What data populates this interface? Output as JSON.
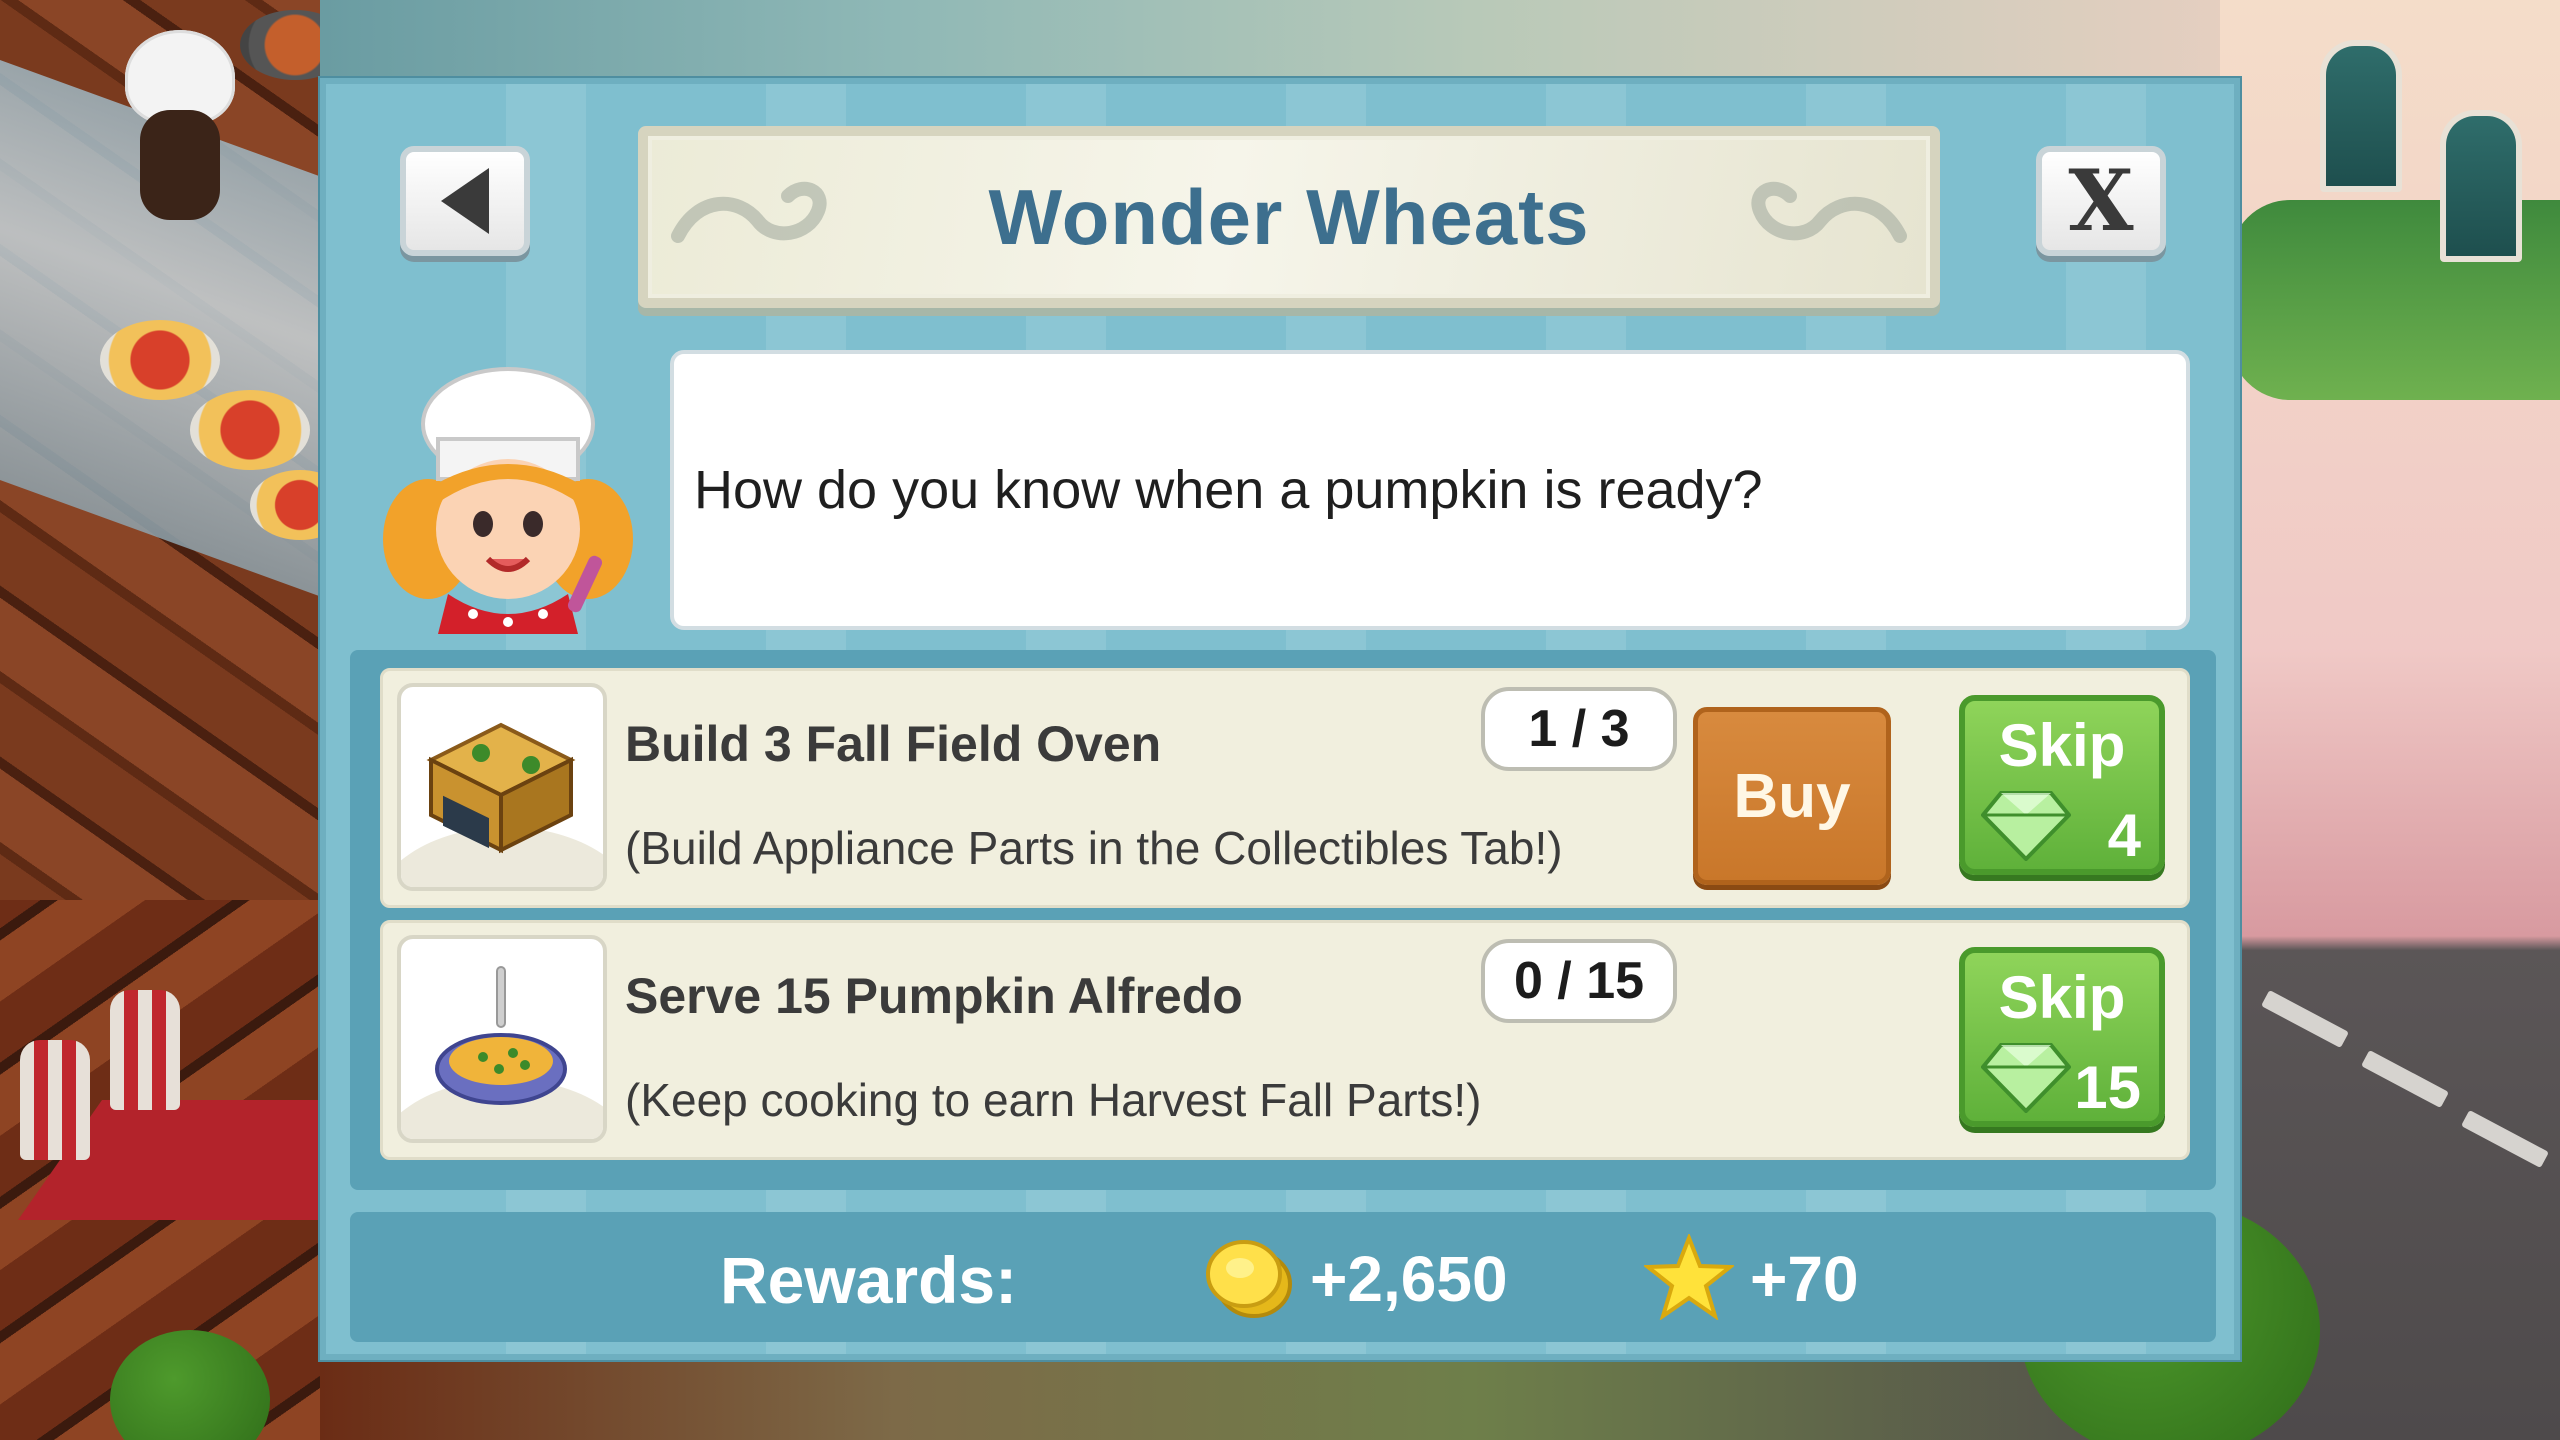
{
  "dialog": {
    "title": "Wonder Wheats",
    "close_label": "X",
    "message": "How do you know when a pumpkin is ready?"
  },
  "tasks": [
    {
      "title": "Build 3 Fall Field Oven",
      "hint": "(Build Appliance Parts in the Collectibles Tab!)",
      "progress": "1 / 3",
      "buy_label": "Buy",
      "skip_label": "Skip",
      "skip_cost": "4",
      "icon": "fall-field-oven-icon"
    },
    {
      "title": "Serve 15 Pumpkin Alfredo",
      "hint": "(Keep cooking to earn Harvest Fall Parts!)",
      "progress": "0 / 15",
      "skip_label": "Skip",
      "skip_cost": "15",
      "icon": "pumpkin-alfredo-icon"
    }
  ],
  "rewards": {
    "label": "Rewards:",
    "coins": "+2,650",
    "stars": "+70"
  },
  "colors": {
    "panel": "#7fbfcf",
    "panel_dark": "#5aa1b6",
    "title_text": "#3d6f8e",
    "buy": "#c9772a",
    "skip": "#5fb13a"
  }
}
